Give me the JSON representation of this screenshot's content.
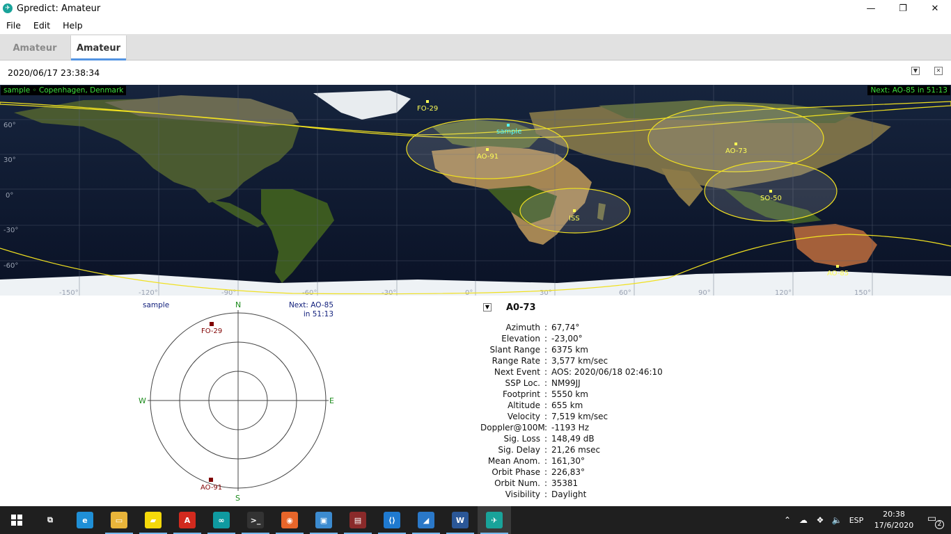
{
  "window": {
    "title": "Gpredict: Amateur",
    "minimize": "—",
    "restore": "❐",
    "close": "✕"
  },
  "menu": [
    "File",
    "Edit",
    "Help"
  ],
  "tabs": [
    {
      "label": "Amateur",
      "active": false
    },
    {
      "label": "Amateur",
      "active": true
    }
  ],
  "module": {
    "time": "2020/06/17 23:38:34",
    "btn_options": "▼",
    "btn_close": "✕"
  },
  "map": {
    "qth_label": "sample ◦ Copenhagen, Denmark",
    "next_label": "Next: AO-85 in 51:13",
    "lat_labels": [
      "60°",
      "30°",
      "0°",
      "-30°",
      "-60°"
    ],
    "lon_labels": [
      "-150°",
      "-120°",
      "-90°",
      "-60°",
      "-30°",
      "0°",
      "30°",
      "60°",
      "90°",
      "120°",
      "150°"
    ],
    "ground_station": "sample",
    "satellites": [
      "FO-29",
      "AO-91",
      "AO-73",
      "SO-50",
      "ISS",
      "AO-85"
    ],
    "colors": {
      "footprint": "#ffff00",
      "label": "#ffff55",
      "qth": "#55ffff",
      "tag_text": "#3de03d"
    }
  },
  "polar": {
    "qth": "sample",
    "next_line1": "Next: AO-85",
    "next_line2": "in 51:13",
    "north": "N",
    "south": "S",
    "east": "E",
    "west": "W",
    "sats": [
      "FO-29",
      "AO-91"
    ]
  },
  "info": {
    "toggle": "▼",
    "sat_name": "A0-73",
    "rows": [
      {
        "label": "Azimuth",
        "value": "67,74°"
      },
      {
        "label": "Elevation",
        "value": "-23,00°"
      },
      {
        "label": "Slant Range",
        "value": "6375 km"
      },
      {
        "label": "Range Rate",
        "value": "3,577 km/sec"
      },
      {
        "label": "Next Event",
        "value": "AOS: 2020/06/18 02:46:10"
      },
      {
        "label": "SSP Loc.",
        "value": "NM99JJ"
      },
      {
        "label": "Footprint",
        "value": "5550 km"
      },
      {
        "label": "Altitude",
        "value": "655 km"
      },
      {
        "label": "Velocity",
        "value": "7,519 km/sec"
      },
      {
        "label": "Doppler@100M",
        "value": "-1193 Hz"
      },
      {
        "label": "Sig. Loss",
        "value": "148,49 dB"
      },
      {
        "label": "Sig. Delay",
        "value": "21,26 msec"
      },
      {
        "label": "Mean Anom.",
        "value": "161,30°"
      },
      {
        "label": "Orbit Phase",
        "value": "226,83°"
      },
      {
        "label": "Orbit Num.",
        "value": "35381"
      },
      {
        "label": "Visibility",
        "value": "Daylight"
      }
    ],
    "separator": ":"
  },
  "taskbar": {
    "apps": [
      {
        "name": "task-view",
        "glyph": "⧉",
        "color": "#1f1f1f"
      },
      {
        "name": "edge",
        "glyph": "e",
        "color": "#1f8fd6"
      },
      {
        "name": "file-explorer",
        "glyph": "▭",
        "color": "#e8b43a"
      },
      {
        "name": "sticky-notes",
        "glyph": "▰",
        "color": "#f5d90a"
      },
      {
        "name": "acrobat",
        "glyph": "A",
        "color": "#d22a1e"
      },
      {
        "name": "arduino",
        "glyph": "∞",
        "color": "#0f9aa0"
      },
      {
        "name": "terminal",
        "glyph": ">_",
        "color": "#333333"
      },
      {
        "name": "firefox",
        "glyph": "◉",
        "color": "#e8662a"
      },
      {
        "name": "control-panel",
        "glyph": "▣",
        "color": "#3c8bd0"
      },
      {
        "name": "winrar",
        "glyph": "▤",
        "color": "#8a2a2a"
      },
      {
        "name": "vscode",
        "glyph": "⟨⟩",
        "color": "#1f7ad0"
      },
      {
        "name": "wireshark",
        "glyph": "◢",
        "color": "#2a78c8"
      },
      {
        "name": "word",
        "glyph": "W",
        "color": "#2b5797"
      },
      {
        "name": "gpredict",
        "glyph": "✈",
        "color": "#19a39a"
      }
    ],
    "tray_lang": "ESP",
    "time": "20:38",
    "date": "17/6/2020",
    "notif_count": "2"
  }
}
